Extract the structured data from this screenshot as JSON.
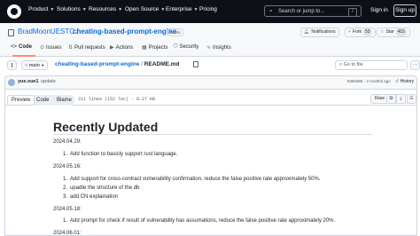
{
  "header": {
    "nav": [
      {
        "label": "Product",
        "has_caret": true
      },
      {
        "label": "Solutions",
        "has_caret": true
      },
      {
        "label": "Resources",
        "has_caret": true
      },
      {
        "label": "Open Source",
        "has_caret": true
      },
      {
        "label": "Enterprise",
        "has_caret": true
      },
      {
        "label": "Pricing",
        "has_caret": false
      }
    ],
    "search_placeholder": "Search or jump to...",
    "search_shortcut": "/",
    "sign_in": "Sign in",
    "sign_up": "Sign up"
  },
  "repo": {
    "owner": "BradMoonUESTC",
    "separator": "/",
    "name": "cheating-based-prompt-engine",
    "visibility": "Public",
    "notifications_label": "Notifications",
    "fork_label": "Fork",
    "fork_count": "53",
    "star_label": "Star",
    "star_count": "415",
    "tabs": [
      {
        "label": "Code",
        "icon": "code-icon"
      },
      {
        "label": "Issues",
        "icon": "issues-icon"
      },
      {
        "label": "Pull requests",
        "icon": "pull-request-icon"
      },
      {
        "label": "Actions",
        "icon": "actions-icon"
      },
      {
        "label": "Projects",
        "icon": "projects-icon"
      },
      {
        "label": "Security",
        "icon": "security-icon"
      },
      {
        "label": "Insights",
        "icon": "insights-icon"
      }
    ]
  },
  "file_nav": {
    "branch": "main",
    "path_repo": "cheating-based-prompt-engine",
    "path_sep": "/",
    "path_file": "README.md",
    "go_to_file": "Go to file"
  },
  "commit": {
    "author": "yue.xue1",
    "message": "update",
    "meta": "838e986 · 2 months ago",
    "history": "History"
  },
  "file": {
    "tabs": [
      "Preview",
      "Code",
      "Blame"
    ],
    "active_tab": "Preview",
    "info": "211 lines (152 loc) · 8.27 KB",
    "raw": "Raw"
  },
  "readme": {
    "title": "Recently Updated",
    "sections": [
      {
        "date": "2024.04.29:",
        "items": [
          "Add function to basicly support rust language."
        ]
      },
      {
        "date": "2024.05.16:",
        "items": [
          "Add support for cross-contract vulnerability confirmation, reduce the false positive rate approximately 50%.",
          "upadte the structure of the db",
          "add CN explaination"
        ]
      },
      {
        "date": "2024.05.18:",
        "items": [
          "Add prompt for check if result of vulnerability has assumations, reduce the false positive rate approximately 20%."
        ]
      },
      {
        "date": "2024.06.01:",
        "items": []
      }
    ]
  },
  "colors": {
    "header_bg": "#0d1117",
    "link": "#0969da",
    "tab_underline": "#fd8c73",
    "border": "#d0d7de"
  }
}
